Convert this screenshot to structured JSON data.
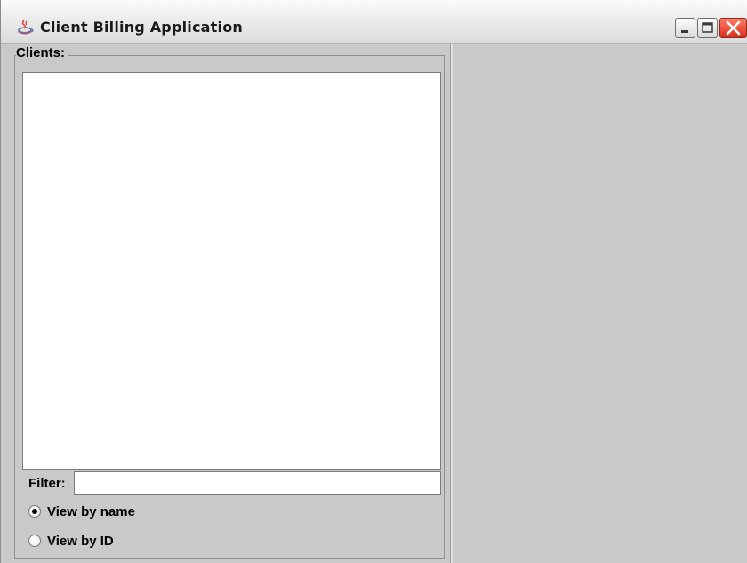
{
  "window": {
    "title": "Client Billing Application",
    "icon": "java-coffee-cup-icon",
    "controls": [
      "minimize-icon",
      "maximize-icon",
      "close-icon"
    ]
  },
  "clients_panel": {
    "title": "Clients:",
    "items": [],
    "filter": {
      "label": "Filter:",
      "value": "",
      "placeholder": ""
    },
    "view_options": [
      {
        "label": "View by name",
        "selected": true
      },
      {
        "label": "View by ID",
        "selected": false
      }
    ]
  },
  "colors": {
    "panel_background": "#c9c9c9",
    "list_background": "#ffffff",
    "close_button": "#d8301b"
  }
}
